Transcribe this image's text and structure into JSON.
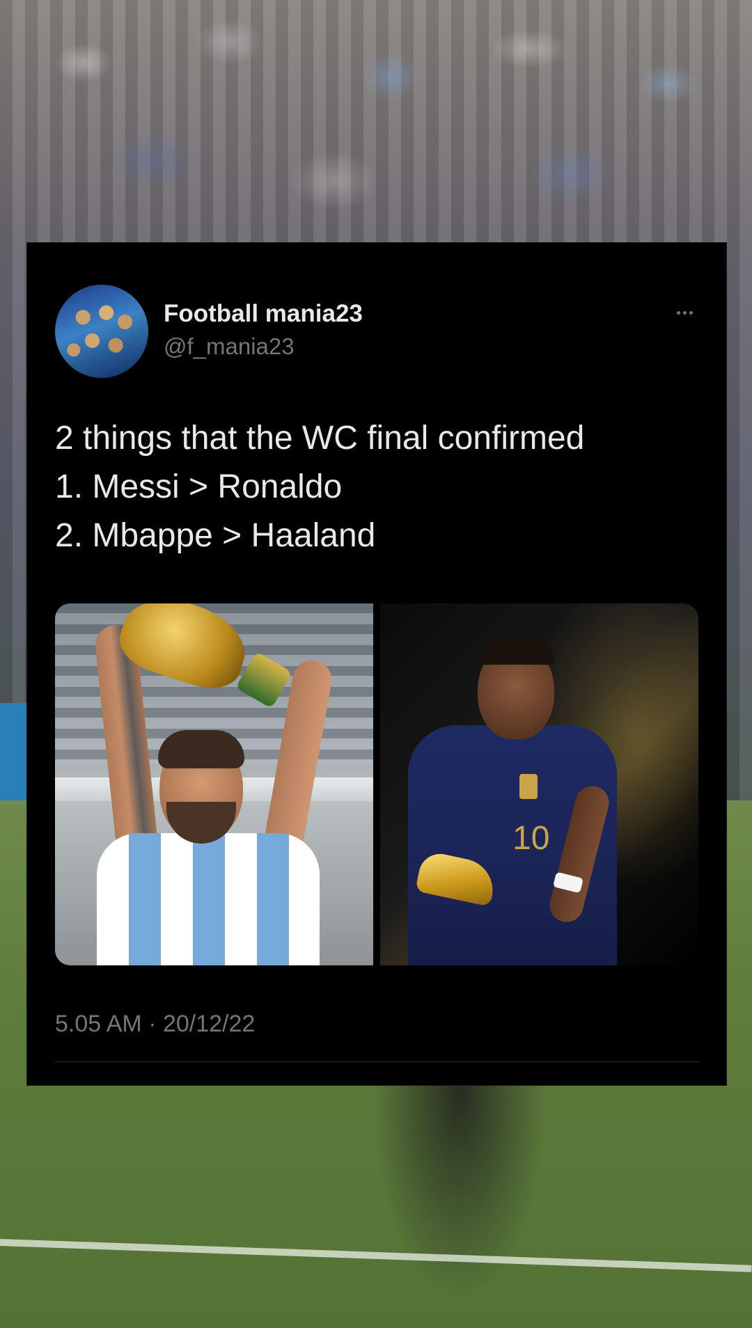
{
  "tweet": {
    "author": {
      "display_name": "Football mania23",
      "handle": "@f_mania23"
    },
    "text_lines": [
      "2 things that the WC final confirmed",
      "1. Messi > Ronaldo",
      "2. Mbappe > Haaland"
    ],
    "media": {
      "right_photo_jersey_number": "10"
    },
    "timestamp": "5.05 AM · 20/12/22"
  },
  "icons": {
    "more": "more-horizontal-icon"
  },
  "colors": {
    "card_background": "#000000",
    "primary_text": "#e7e9ea",
    "secondary_text": "#71767b",
    "divider": "#2f3336"
  }
}
